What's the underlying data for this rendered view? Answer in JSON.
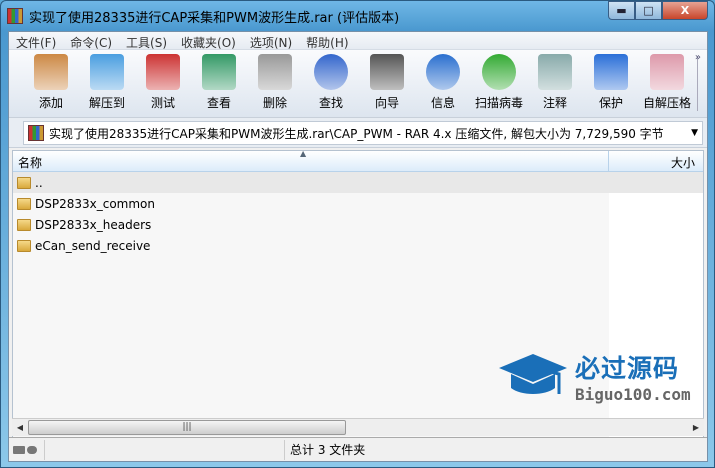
{
  "window": {
    "title": "实现了使用28335进行CAP采集和PWM波形生成.rar (评估版本)",
    "minimize": "▬",
    "maximize": "□",
    "close": "X"
  },
  "menu": [
    "文件(F)",
    "命令(C)",
    "工具(S)",
    "收藏夹(O)",
    "选项(N)",
    "帮助(H)"
  ],
  "toolbar": [
    {
      "label": "添加",
      "icon": "add-archive-icon",
      "color": "#c84"
    },
    {
      "label": "解压到",
      "icon": "extract-folder-icon",
      "color": "#4a9ee0"
    },
    {
      "label": "测试",
      "icon": "test-clipboard-icon",
      "color": "#c33"
    },
    {
      "label": "查看",
      "icon": "view-book-icon",
      "color": "#396"
    },
    {
      "label": "删除",
      "icon": "trash-icon",
      "color": "#999"
    },
    {
      "label": "查找",
      "icon": "magnifier-icon",
      "color": "#36c"
    },
    {
      "label": "向导",
      "icon": "wizard-wand-icon",
      "color": "#555"
    },
    {
      "label": "信息",
      "icon": "info-icon",
      "color": "#2a6fcf"
    },
    {
      "label": "扫描病毒",
      "icon": "virus-scan-icon",
      "color": "#3a3"
    },
    {
      "label": "注释",
      "icon": "comment-icon",
      "color": "#8aa"
    },
    {
      "label": "保护",
      "icon": "shield-icon",
      "color": "#2a6fd8"
    },
    {
      "label": "自解压格",
      "icon": "sfx-box-icon",
      "color": "#d9a"
    }
  ],
  "address": {
    "path": "实现了使用28335进行CAP采集和PWM波形生成.rar\\CAP_PWM - RAR 4.x 压缩文件, 解包大小为 7,729,590 字节",
    "dropdown": "▼"
  },
  "columns": {
    "name": "名称",
    "size": "大小"
  },
  "files": [
    {
      "name": ".."
    },
    {
      "name": "DSP2833x_common"
    },
    {
      "name": "DSP2833x_headers"
    },
    {
      "name": "eCan_send_receive"
    }
  ],
  "watermark": {
    "cn": "必过源码",
    "en": "Biguo100.com"
  },
  "status": {
    "total": "总计 3 文件夹"
  }
}
